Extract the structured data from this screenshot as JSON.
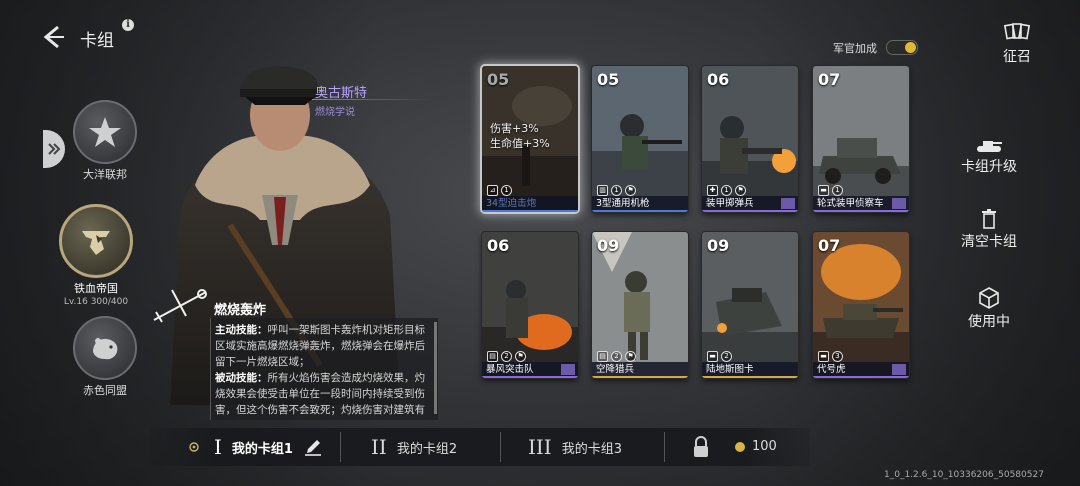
{
  "header": {
    "title": "卡组",
    "info_glyph": "i"
  },
  "factions": [
    {
      "label": "大洋联邦"
    },
    {
      "label": "铁血帝国",
      "level": "Lv.16  300/400",
      "active": true
    },
    {
      "label": "赤色同盟"
    }
  ],
  "general": {
    "name": "奥古斯特",
    "doctrine": "燃烧学说"
  },
  "skill": {
    "title": "燃烧轰炸",
    "active_label": "主动技能：",
    "active_text": "呼叫一架斯图卡轰炸机对矩形目标区域实施高爆燃烧弹轰炸，燃烧弹会在爆炸后留下一片燃烧区域；",
    "passive_label": "被动技能：",
    "passive_text": "所有火焰伤害会造成灼烧效果，灼烧效果会使受击单位在一段时间内持续受到伤害，但这个伤害不会致死；灼烧伤害对建筑有额外伤害。"
  },
  "officer_bonus": {
    "label": "军官加成",
    "enabled": true
  },
  "recruit": {
    "label": "征召"
  },
  "cards": [
    {
      "cost": "05",
      "name": "34型迫击炮",
      "count": "1",
      "stats": [
        "伤害+3%",
        "生命值+3%"
      ],
      "rarity": "blue",
      "dim": true
    },
    {
      "cost": "05",
      "name": "3型通用机枪",
      "count": "1",
      "rarity": "blue"
    },
    {
      "cost": "06",
      "name": "装甲掷弹兵",
      "count": "1",
      "rarity": "purple"
    },
    {
      "cost": "07",
      "name": "轮式装甲侦察车",
      "count": "1",
      "rarity": "purple"
    },
    {
      "cost": "06",
      "name": "暴风突击队",
      "count": "2",
      "rarity": "purple"
    },
    {
      "cost": "09",
      "name": "空降猎兵",
      "count": "2",
      "rarity": "gold"
    },
    {
      "cost": "09",
      "name": "陆地斯图卡",
      "count": "2",
      "rarity": "gold"
    },
    {
      "cost": "07",
      "name": "代号虎",
      "count": "3",
      "rarity": "purple"
    }
  ],
  "right_menu": {
    "upgrade": "卡组升级",
    "clear": "清空卡组",
    "in_use": "使用中"
  },
  "decks": [
    {
      "roman": "I",
      "name": "我的卡组1",
      "active": true
    },
    {
      "roman": "II",
      "name": "我的卡组2"
    },
    {
      "roman": "III",
      "name": "我的卡组3"
    }
  ],
  "currency": {
    "value": "100"
  },
  "version": "1_0_1.2.6_10_10336206_50580527",
  "colors": {
    "accent_gold": "#e0b73a",
    "general_name": "#b9a4ff",
    "rarity_blue": "#4b7bd6",
    "rarity_purple": "#8a6bd6",
    "rarity_gold": "#d6a64b"
  }
}
